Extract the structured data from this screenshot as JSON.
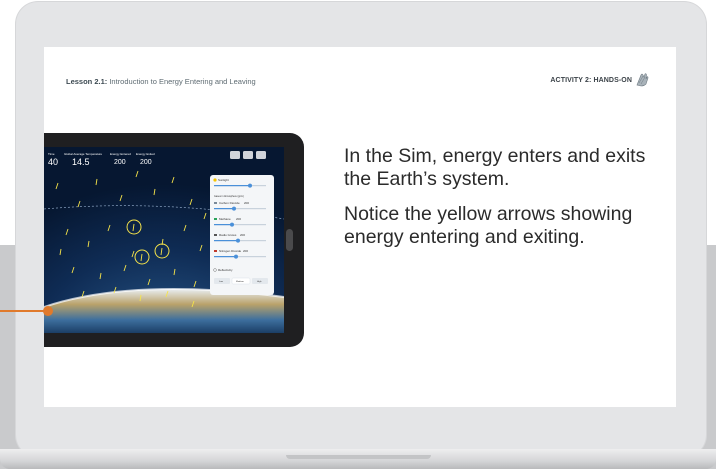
{
  "slide": {
    "lesson_bold": "Lesson 2.1:",
    "lesson_rest": " Introduction to Energy Entering and Leaving",
    "activity": "ACTIVITY 2: HANDS-ON",
    "text1": "In the Sim, energy enters and exits the Earth’s system.",
    "text2": "Notice the yellow arrows showing energy entering and exiting."
  },
  "sim": {
    "time_label": "Time",
    "time_value": "40",
    "temp_label": "Global Average Temperature",
    "temp_value": "14.5",
    "energy_entered_label": "Energy Entered",
    "energy_entered_value": "200",
    "energy_exited_label": "Energy Exited",
    "energy_exited_value": "200",
    "panel": {
      "sunlight": "Sunlight",
      "gases_title": "Gases in Atmosphere (ppm)",
      "co2_label": "Carbon Dioxide",
      "co2_value": "200",
      "methane_label": "Methane",
      "methane_value": "200",
      "radio_label": "Radio Grows",
      "radio_value": "200",
      "nitrogen_label": "Nitrogen Dioxide",
      "nitrogen_value": "200",
      "reflectivity": "Reflectivity",
      "btn1": "Low",
      "btn2": "Medium",
      "btn3": "High"
    }
  },
  "colors": {
    "accent_orange": "#e07a2c",
    "arrow_yellow": "#f5e34a",
    "slider_blue": "#4a90d9"
  }
}
